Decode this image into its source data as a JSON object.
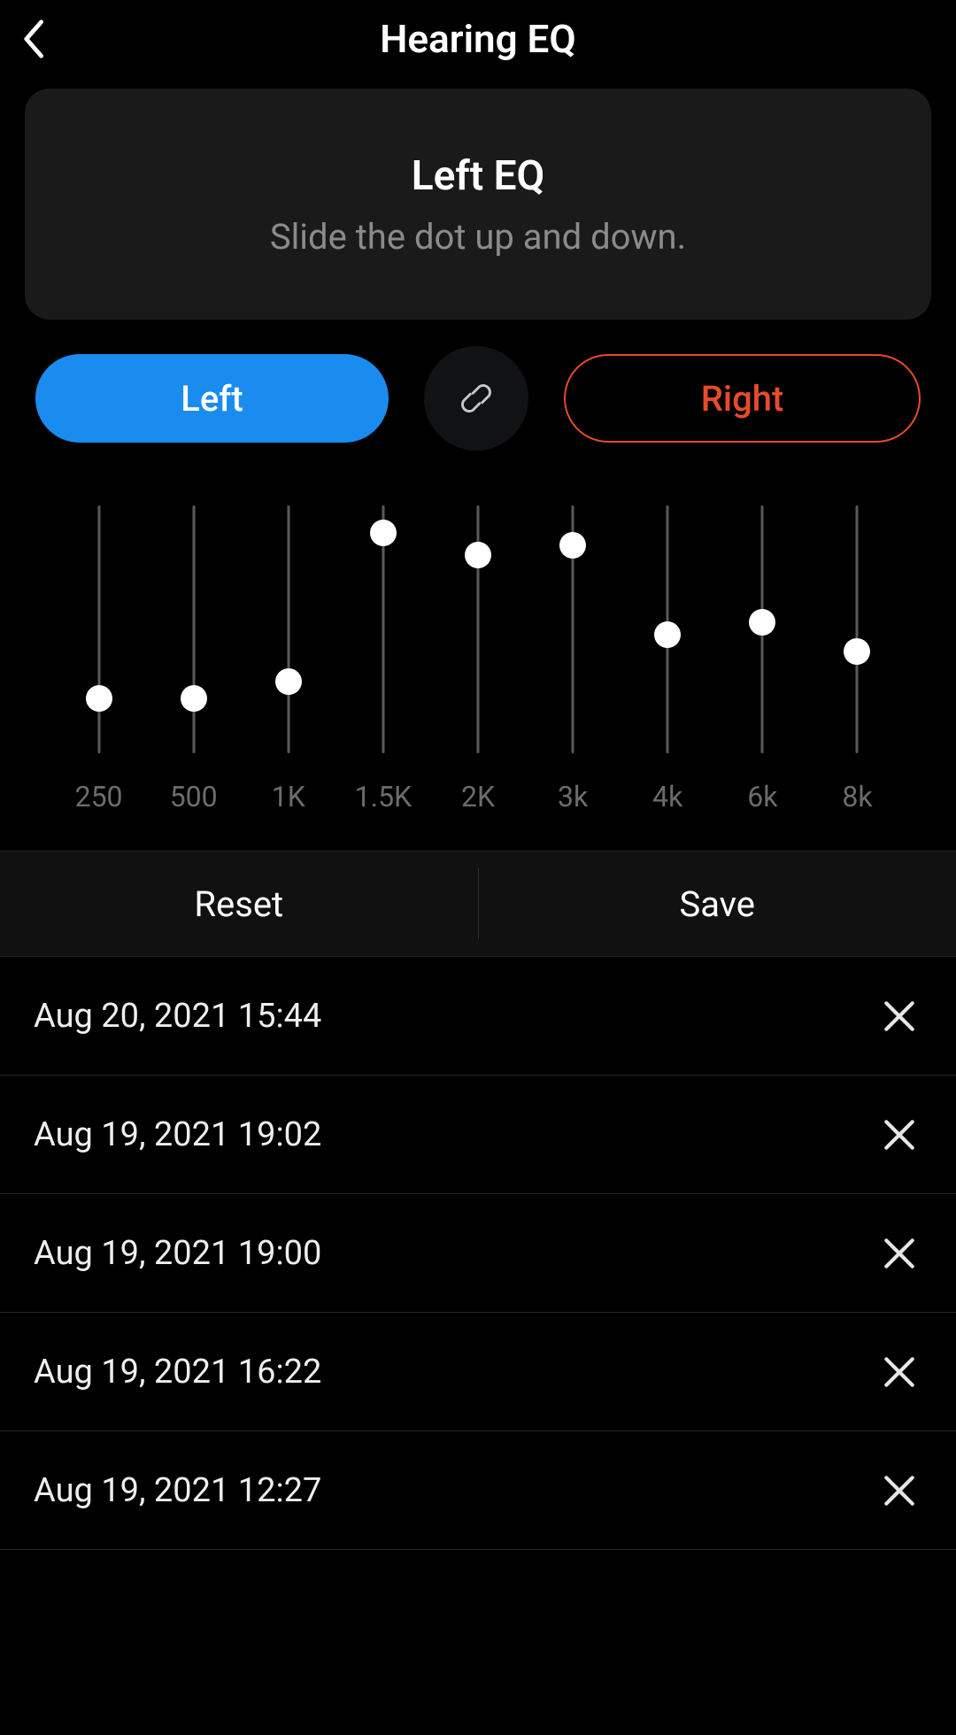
{
  "header": {
    "title": "Hearing EQ"
  },
  "banner": {
    "title": "Left EQ",
    "subtitle": "Slide the dot up and down."
  },
  "tabs": {
    "left_label": "Left",
    "right_label": "Right",
    "active": "Left"
  },
  "eq": {
    "bands": [
      {
        "label": "250",
        "value": 0.22
      },
      {
        "label": "500",
        "value": 0.22
      },
      {
        "label": "1K",
        "value": 0.29
      },
      {
        "label": "1.5K",
        "value": 0.89
      },
      {
        "label": "2K",
        "value": 0.8
      },
      {
        "label": "3k",
        "value": 0.84
      },
      {
        "label": "4k",
        "value": 0.48
      },
      {
        "label": "6k",
        "value": 0.53
      },
      {
        "label": "8k",
        "value": 0.41
      }
    ]
  },
  "actions": {
    "reset_label": "Reset",
    "save_label": "Save"
  },
  "history": [
    {
      "label": "Aug 20, 2021 15:44"
    },
    {
      "label": "Aug 19, 2021 19:02"
    },
    {
      "label": "Aug 19, 2021 19:00"
    },
    {
      "label": "Aug 19, 2021 16:22"
    },
    {
      "label": "Aug 19, 2021 12:27"
    }
  ],
  "colors": {
    "accent_blue": "#1a8cf0",
    "accent_orange": "#e74b29"
  }
}
